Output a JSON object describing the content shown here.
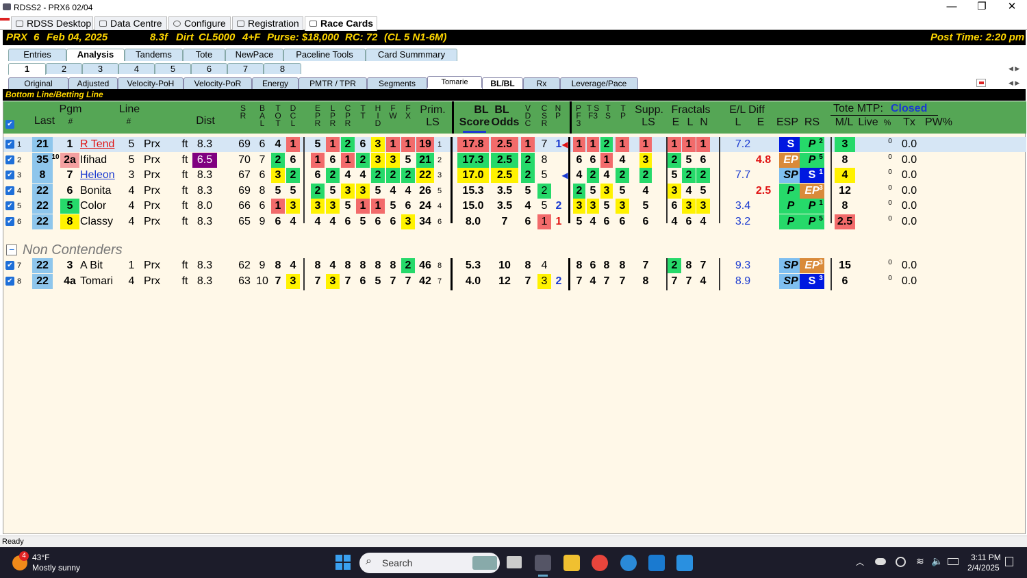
{
  "window": {
    "title": "RDSS2 - PRX6  02/04",
    "min": "—",
    "max": "❐",
    "close": "✕"
  },
  "top_tabs": [
    "RDSS Desktop",
    "Data Centre",
    "Configure",
    "Registration",
    "Race Cards"
  ],
  "header": {
    "track": "PRX",
    "race": "6",
    "date": "Feb 04, 2025",
    "distance": "8.3f",
    "surface": "Dirt",
    "race_class": "CL5000",
    "age": "4+F",
    "purse": "Purse: $18,000",
    "rc": "RC: 72",
    "cond": "(CL 5 N1-6M)",
    "post_time": "Post Time: 2:20 pm"
  },
  "tabs_l1": [
    "Entries",
    "Analysis",
    "Tandems",
    "Tote",
    "NewPace",
    "Paceline Tools",
    "Card Summmary"
  ],
  "tabs_l2": [
    "1",
    "2",
    "3",
    "4",
    "5",
    "6",
    "7",
    "8"
  ],
  "tabs_l3": [
    "Original",
    "Adjusted",
    "Velocity-PoH",
    "Velocity-PoR",
    "Energy",
    "PMTR / TPR",
    "Segments",
    "Tomarie",
    "BL/BL",
    "Rx",
    "Leverage/Pace"
  ],
  "section_title": "Bottom Line/Betting Line",
  "columns": {
    "last": "Last",
    "pgm": "Pgm",
    "pgm_sub": "#",
    "line": "Line",
    "line_sub": "#",
    "dist": "Dist",
    "sr": "S R",
    "bal": "B A L",
    "tot": "T O T",
    "dcl": "D C L",
    "epr": "E P R",
    "lpr": "L P R",
    "cpr": "C P R",
    "tt": "T T",
    "hid": "H I D",
    "fw": "F W",
    "fx": "F X",
    "prim": "Prim.",
    "prim_sub": "LS",
    "blscore": "BL",
    "blscore_sub": "Score",
    "blodds": "BL",
    "blodds_sub": "Odds",
    "vdc": "V D C",
    "csr": "C S R",
    "np": "N P",
    "pf3": "P F 3",
    "tsf3": "T S F3",
    "ts": "T S",
    "tp": "T P",
    "supp": "Supp.",
    "supp_sub": "LS",
    "fractals": "Fractals",
    "fr_e": "E",
    "fr_l": "L",
    "fr_n": "N",
    "eldiff": "E/L Diff",
    "el_l": "L",
    "el_e": "E",
    "esp": "ESP",
    "rs": "RS",
    "tote_mtp": "Tote MTP:",
    "tote_status": "Closed",
    "ml": "M/L",
    "live": "Live",
    "pct": "%",
    "tx": "Tx",
    "pw": "PW%"
  },
  "rows": [
    {
      "n": "1",
      "last": "21",
      "lsup": "",
      "pgm": "1",
      "name": "R Tend",
      "line": "5",
      "trk": "Prx",
      "ft": "ft",
      "dist": "8.3",
      "sr": "69",
      "bal": "6",
      "tot": "4",
      "dcl": "1",
      "epr": "5",
      "lpr": "1",
      "cpr": "2",
      "tt": "6",
      "hid": "3",
      "fw": "1",
      "fx": "1",
      "prim": "19",
      "primsub": "1",
      "bls": "17.8",
      "blo": "2.5",
      "vdc": "1",
      "csr": "7",
      "np": "1",
      "pf3": "1",
      "tsf3": "1",
      "ts": "2",
      "tp": "1",
      "supp": "1",
      "fe": "1",
      "fl": "1",
      "fn": "1",
      "ell": "7.2",
      "ele": "",
      "esp": "S",
      "rs": "P",
      "rssup": "2",
      "ml": "3",
      "pct": "0",
      "tx": "0.0"
    },
    {
      "n": "2",
      "last": "35",
      "lsup": "10",
      "pgm": "2a",
      "name": "Ifihad",
      "line": "5",
      "trk": "Prx",
      "ft": "ft",
      "dist": "6.5",
      "sr": "70",
      "bal": "7",
      "tot": "2",
      "dcl": "6",
      "epr": "1",
      "lpr": "6",
      "cpr": "1",
      "tt": "2",
      "hid": "3",
      "fw": "3",
      "fx": "5",
      "prim": "21",
      "primsub": "2",
      "bls": "17.3",
      "blo": "2.5",
      "vdc": "2",
      "csr": "8",
      "np": "",
      "pf3": "6",
      "tsf3": "6",
      "ts": "1",
      "tp": "4",
      "supp": "3",
      "fe": "2",
      "fl": "5",
      "fn": "6",
      "ell": "",
      "ele": "4.8",
      "esp": "EP",
      "rs": "P",
      "rssup": "5",
      "ml": "8",
      "pct": "0",
      "tx": "0.0"
    },
    {
      "n": "3",
      "last": "8",
      "lsup": "",
      "pgm": "7",
      "name": "Heleon",
      "line": "3",
      "trk": "Prx",
      "ft": "ft",
      "dist": "8.3",
      "sr": "67",
      "bal": "6",
      "tot": "3",
      "dcl": "2",
      "epr": "6",
      "lpr": "2",
      "cpr": "4",
      "tt": "4",
      "hid": "2",
      "fw": "2",
      "fx": "2",
      "prim": "22",
      "primsub": "3",
      "bls": "17.0",
      "blo": "2.5",
      "vdc": "2",
      "csr": "5",
      "np": "",
      "pf3": "4",
      "tsf3": "2",
      "ts": "4",
      "tp": "2",
      "supp": "2",
      "fe": "5",
      "fl": "2",
      "fn": "2",
      "ell": "7.7",
      "ele": "",
      "esp": "SP",
      "rs": "S",
      "rssup": "1",
      "ml": "4",
      "pct": "0",
      "tx": "0.0"
    },
    {
      "n": "4",
      "last": "22",
      "lsup": "",
      "pgm": "6",
      "name": "Bonita",
      "line": "4",
      "trk": "Prx",
      "ft": "ft",
      "dist": "8.3",
      "sr": "69",
      "bal": "8",
      "tot": "5",
      "dcl": "5",
      "epr": "2",
      "lpr": "5",
      "cpr": "3",
      "tt": "3",
      "hid": "5",
      "fw": "4",
      "fx": "4",
      "prim": "26",
      "primsub": "5",
      "bls": "15.3",
      "blo": "3.5",
      "vdc": "5",
      "csr": "2",
      "np": "",
      "pf3": "2",
      "tsf3": "5",
      "ts": "3",
      "tp": "5",
      "supp": "4",
      "fe": "3",
      "fl": "4",
      "fn": "5",
      "ell": "",
      "ele": "2.5",
      "esp": "P",
      "rs": "EP",
      "rssup": "3",
      "ml": "12",
      "pct": "0",
      "tx": "0.0"
    },
    {
      "n": "5",
      "last": "22",
      "lsup": "",
      "pgm": "5",
      "name": "Color",
      "line": "4",
      "trk": "Prx",
      "ft": "ft",
      "dist": "8.0",
      "sr": "66",
      "bal": "6",
      "tot": "1",
      "dcl": "3",
      "epr": "3",
      "lpr": "3",
      "cpr": "5",
      "tt": "1",
      "hid": "1",
      "fw": "5",
      "fx": "6",
      "prim": "24",
      "primsub": "4",
      "bls": "15.0",
      "blo": "3.5",
      "vdc": "4",
      "csr": "5",
      "np": "2",
      "pf3": "3",
      "tsf3": "3",
      "ts": "5",
      "tp": "3",
      "supp": "5",
      "fe": "6",
      "fl": "3",
      "fn": "3",
      "ell": "3.4",
      "ele": "",
      "esp": "P",
      "rs": "P",
      "rssup": "1",
      "ml": "8",
      "pct": "0",
      "tx": "0.0"
    },
    {
      "n": "6",
      "last": "22",
      "lsup": "",
      "pgm": "8",
      "name": "Classy",
      "line": "4",
      "trk": "Prx",
      "ft": "ft",
      "dist": "8.3",
      "sr": "65",
      "bal": "9",
      "tot": "6",
      "dcl": "4",
      "epr": "4",
      "lpr": "4",
      "cpr": "6",
      "tt": "5",
      "hid": "6",
      "fw": "6",
      "fx": "3",
      "prim": "34",
      "primsub": "6",
      "bls": "8.0",
      "blo": "7",
      "vdc": "6",
      "csr": "1",
      "np": "1",
      "pf3": "5",
      "tsf3": "4",
      "ts": "6",
      "tp": "6",
      "supp": "6",
      "fe": "4",
      "fl": "6",
      "fn": "4",
      "ell": "3.2",
      "ele": "",
      "esp": "P",
      "rs": "P",
      "rssup": "5",
      "ml": "2.5",
      "pct": "0",
      "tx": "0.0"
    }
  ],
  "non_contenders_label": "Non Contenders",
  "nc_rows": [
    {
      "n": "7",
      "last": "22",
      "pgm": "3",
      "name": "A Bit",
      "line": "1",
      "trk": "Prx",
      "ft": "ft",
      "dist": "8.3",
      "sr": "62",
      "bal": "9",
      "tot": "8",
      "dcl": "4",
      "epr": "8",
      "lpr": "4",
      "cpr": "8",
      "tt": "8",
      "hid": "8",
      "fw": "8",
      "fx": "2",
      "prim": "46",
      "primsub": "8",
      "bls": "5.3",
      "blo": "10",
      "vdc": "8",
      "csr": "4",
      "np": "",
      "pf3": "8",
      "tsf3": "6",
      "ts": "8",
      "tp": "8",
      "supp": "7",
      "fe": "2",
      "fl": "8",
      "fn": "7",
      "ell": "9.3",
      "esp": "SP",
      "rs": "EP",
      "rssup": "3",
      "ml": "15",
      "pct": "0",
      "tx": "0.0"
    },
    {
      "n": "8",
      "last": "22",
      "pgm": "4a",
      "name": "Tomari",
      "line": "4",
      "trk": "Prx",
      "ft": "ft",
      "dist": "8.3",
      "sr": "63",
      "bal": "10",
      "tot": "7",
      "dcl": "3",
      "epr": "7",
      "lpr": "3",
      "cpr": "7",
      "tt": "6",
      "hid": "5",
      "fw": "7",
      "fx": "7",
      "prim": "42",
      "primsub": "7",
      "bls": "4.0",
      "blo": "12",
      "vdc": "7",
      "csr": "3",
      "np": "2",
      "pf3": "7",
      "tsf3": "4",
      "ts": "7",
      "tp": "7",
      "supp": "8",
      "fe": "7",
      "fl": "7",
      "fn": "4",
      "ell": "8.9",
      "esp": "SP",
      "rs": "S",
      "rssup": "3",
      "ml": "6",
      "pct": "0",
      "tx": "0.0"
    }
  ],
  "status": "Ready",
  "taskbar": {
    "weather_temp": "43°F",
    "weather_desc": "Mostly sunny",
    "weather_badge": "4",
    "search": "Search",
    "time": "3:11 PM",
    "date": "2/4/2025"
  }
}
